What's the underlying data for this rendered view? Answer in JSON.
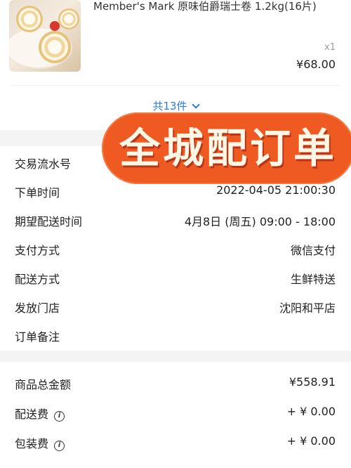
{
  "product": {
    "title": "Member's Mark 原味伯爵瑞士卷 1.2kg(16片)",
    "quantity": "x1",
    "price": "¥68.00",
    "image_icon": "swiss-roll-image"
  },
  "expand": {
    "label": "共13件",
    "icon": "chevron-down-icon"
  },
  "stamp": {
    "text": "全城配订单",
    "color": "#ef5a22"
  },
  "order_info": [
    {
      "label": "交易流水号",
      "value": ""
    },
    {
      "label": "下单时间",
      "value": "2022-04-05 21:00:30"
    },
    {
      "label": "期望配送时间",
      "value": "4月8日 (周五) 09:00 - 18:00"
    },
    {
      "label": "支付方式",
      "value": "微信支付"
    },
    {
      "label": "配送方式",
      "value": "生鲜特送"
    },
    {
      "label": "发放门店",
      "value": "沈阳和平店"
    },
    {
      "label": "订单备注",
      "value": ""
    }
  ],
  "amounts": [
    {
      "label": "商品总金额",
      "value": "¥558.91",
      "info": false
    },
    {
      "label": "配送费",
      "value": "+ ¥ 0.00",
      "info": true
    },
    {
      "label": "包装费",
      "value": "+ ¥ 0.00",
      "info": true
    }
  ],
  "colors": {
    "link": "#2b7bd9",
    "section_gap": "#f4f4f4"
  }
}
